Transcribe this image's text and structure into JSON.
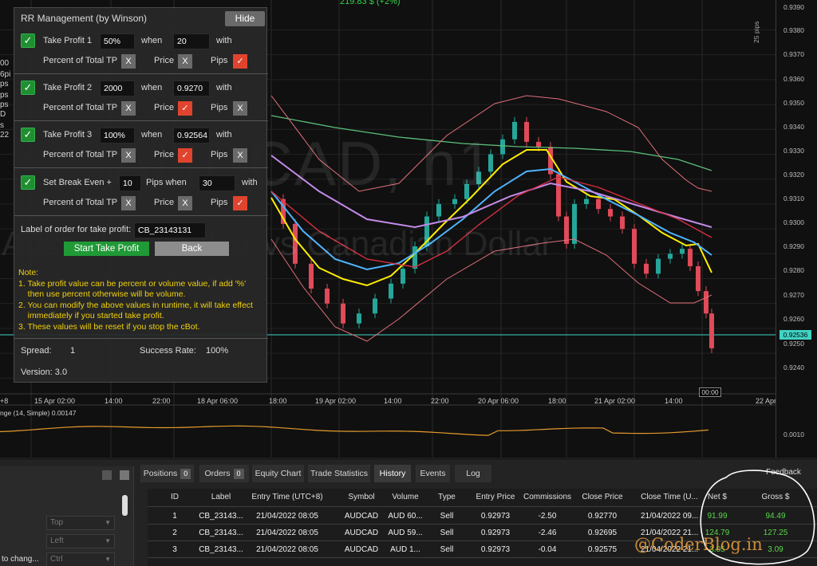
{
  "chart": {
    "header_profit": "219.83 $ (+2%)",
    "watermark_symbol": "AUDCAD, h1",
    "watermark_name": "Australian Dollar vs Canadian Dollar",
    "pip_ruler_label": "25 pips",
    "current_price": "0.92536",
    "price_ticks": [
      "0.9390",
      "0.9380",
      "0.9370",
      "0.9360",
      "0.9350",
      "0.9340",
      "0.9330",
      "0.9320",
      "0.9310",
      "0.9300",
      "0.9290",
      "0.9280",
      "0.9270",
      "0.9260",
      "0.9250",
      "0.9240"
    ],
    "time_labels": [
      "+8",
      "15 Apr 02:00",
      "14:00",
      "22:00",
      "18 Apr 06:00",
      "18:00",
      "19 Apr 02:00",
      "14:00",
      "22:00",
      "20 Apr 06:00",
      "18:00",
      "21 Apr 02:00",
      "14:00",
      "22:00",
      "22 Apr 06:00"
    ],
    "crosshair_time": "00:00",
    "indicator_label": "nge (14, Simple) 0.00147",
    "indicator_tick": "0.0010",
    "left_clipped": [
      "00",
      "6pi",
      "ps",
      "ps",
      "ps",
      "D",
      "s",
      "22"
    ],
    "colors": {
      "bull": "#26a69a",
      "bear": "#e04a59",
      "yellow": "#ffee00",
      "blue": "#4fb3ff",
      "purple": "#c48ae8",
      "red": "#d32f3f",
      "green": "#5bbf7a",
      "pink": "#e0707a",
      "indicator": "#e59a2c",
      "cur_line": "#40d3c4"
    }
  },
  "panel": {
    "title": "RR Management (by Winson)",
    "hide": "Hide",
    "tp1": {
      "label": "Take Profit 1",
      "value": "50%",
      "when": "when",
      "when_value": "20",
      "with": "with"
    },
    "tp2": {
      "label": "Take Profit 2",
      "value": "2000",
      "when": "when",
      "when_value": "0.9270",
      "with": "with"
    },
    "tp3": {
      "label": "Take Profit 3",
      "value": "100%",
      "when": "when",
      "when_value": "0.92564",
      "with": "with"
    },
    "be": {
      "label": "Set Break Even +",
      "value": "10",
      "pips_when": "Pips when",
      "when_value": "30",
      "with": "with"
    },
    "percent_label": "Percent of Total TP",
    "price_label": "Price",
    "pips_label": "Pips",
    "x": "X",
    "check": "✓",
    "order_label": "Label of order for take profit:",
    "order_value": "CB_23143131",
    "start": "Start Take Profit",
    "back": "Back",
    "notes": [
      "Note:",
      "1. Take profit value can be percent or volume value, if add '%'",
      "    then use percent otherwise will be volume.",
      "2. You can modify the above values in runtime, it will take effect",
      "    immediately if you started take profit.",
      "3. These values will be reset if you stop the cBot."
    ],
    "spread_label": "Spread:",
    "spread_value": "1",
    "success_label": "Success Rate:",
    "success_value": "100%",
    "version": "Version: 3.0"
  },
  "bottom": {
    "left": {
      "dropdowns": [
        "Top",
        "Left",
        "Ctrl"
      ],
      "clipped_text": "to chang..."
    },
    "tabs": [
      {
        "label": "Positions",
        "badge": "0"
      },
      {
        "label": "Orders",
        "badge": "0"
      },
      {
        "label": "Equity Chart",
        "badge": ""
      },
      {
        "label": "Trade Statistics",
        "badge": ""
      },
      {
        "label": "History",
        "badge": ""
      },
      {
        "label": "Events",
        "badge": ""
      },
      {
        "label": "Log",
        "badge": ""
      }
    ],
    "feedback": "Feedback",
    "columns": [
      "ID",
      "Label",
      "Entry Time (UTC+8)",
      "Symbol",
      "Volume",
      "Type",
      "Entry Price",
      "Commissions",
      "Close Price",
      "Close Time (U...",
      "Net $",
      "Gross $"
    ],
    "rows": [
      [
        "1",
        "CB_23143...",
        "21/04/2022 08:05",
        "AUDCAD",
        "AUD 60...",
        "Sell",
        "0.92973",
        "-2.50",
        "0.92770",
        "21/04/2022 09...",
        "91.99",
        "94.49"
      ],
      [
        "2",
        "CB_23143...",
        "21/04/2022 08:05",
        "AUDCAD",
        "AUD 59...",
        "Sell",
        "0.92973",
        "-2.46",
        "0.92695",
        "21/04/2022 21...",
        "124.79",
        "127.25"
      ],
      [
        "3",
        "CB_23143...",
        "21/04/2022 08:05",
        "AUDCAD",
        "AUD 1...",
        "Sell",
        "0.92973",
        "-0.04",
        "0.92575",
        "21/04/2022 21...",
        "3.05",
        "3.09"
      ]
    ],
    "watermark": "@CoderBlog.in"
  }
}
